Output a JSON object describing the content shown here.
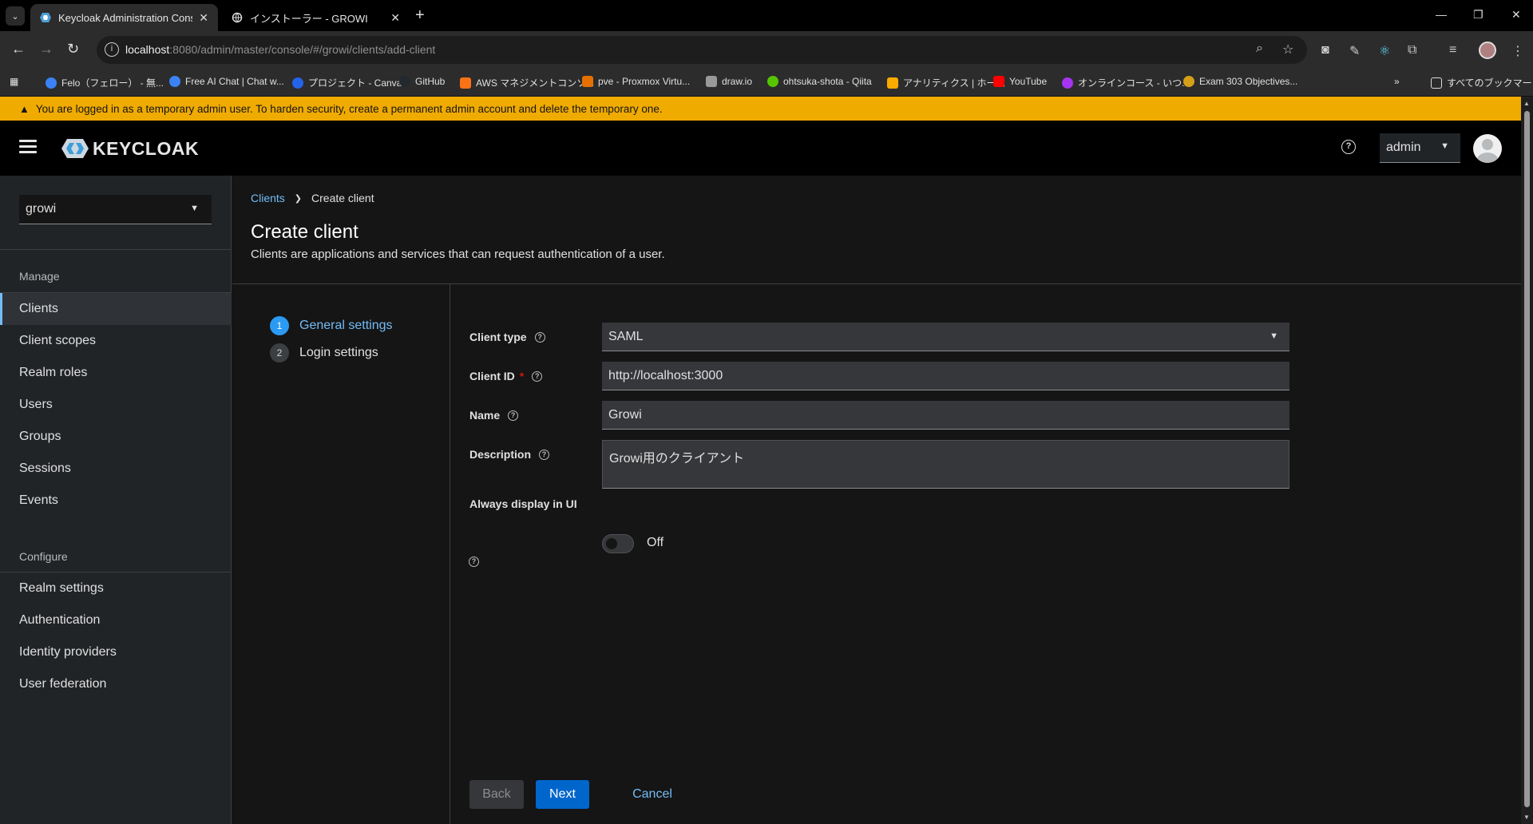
{
  "browser": {
    "tabs": [
      {
        "title": "Keycloak Administration Consol",
        "active": true
      },
      {
        "title": "インストーラー - GROWI",
        "active": false
      }
    ],
    "url_host": "localhost",
    "url_rest": ":8080/admin/master/console/#/growi/clients/add-client",
    "bookmarks": [
      {
        "label": "Felo（フェロー） - 無...",
        "color": "#3b82f6"
      },
      {
        "label": "Free AI Chat | Chat w...",
        "color": "#3b82f6"
      },
      {
        "label": "プロジェクト - Canva",
        "color": "#2563eb"
      },
      {
        "label": "GitHub",
        "color": "#24292f"
      },
      {
        "label": "AWS マネジメントコンソ...",
        "color": "#f97316"
      },
      {
        "label": "pve - Proxmox Virtu...",
        "color": "#e57000"
      },
      {
        "label": "draw.io",
        "color": "#999999"
      },
      {
        "label": "ohtsuka-shota - Qiita",
        "color": "#55c500"
      },
      {
        "label": "アナリティクス | ホーム",
        "color": "#f9ab00"
      },
      {
        "label": "YouTube",
        "color": "#ff0000"
      },
      {
        "label": "オンラインコース - いつ...",
        "color": "#a435f0"
      },
      {
        "label": "Exam 303 Objectives...",
        "color": "#d4a017"
      }
    ],
    "all_bookmarks": "すべてのブックマーク"
  },
  "banner": {
    "text": "You are logged in as a temporary admin user. To harden security, create a permanent admin account and delete the temporary one."
  },
  "masthead": {
    "logo_text": "KEYCLOAK",
    "user": "admin"
  },
  "sidebar": {
    "realm": "growi",
    "manage_heading": "Manage",
    "manage_items": [
      "Clients",
      "Client scopes",
      "Realm roles",
      "Users",
      "Groups",
      "Sessions",
      "Events"
    ],
    "configure_heading": "Configure",
    "configure_items": [
      "Realm settings",
      "Authentication",
      "Identity providers",
      "User federation"
    ]
  },
  "page": {
    "breadcrumb_parent": "Clients",
    "breadcrumb_current": "Create client",
    "title": "Create client",
    "description": "Clients are applications and services that can request authentication of a user."
  },
  "wizard": {
    "steps": [
      {
        "num": "1",
        "label": "General settings"
      },
      {
        "num": "2",
        "label": "Login settings"
      }
    ]
  },
  "form": {
    "client_type_label": "Client type",
    "client_type_value": "SAML",
    "client_id_label": "Client ID",
    "client_id_required": "*",
    "client_id_value": "http://localhost:3000",
    "name_label": "Name",
    "name_value": "Growi",
    "description_label": "Description",
    "description_value": "Growi用のクライアント",
    "always_display_label": "Always display in UI",
    "always_display_state": "Off"
  },
  "buttons": {
    "back": "Back",
    "next": "Next",
    "cancel": "Cancel"
  }
}
